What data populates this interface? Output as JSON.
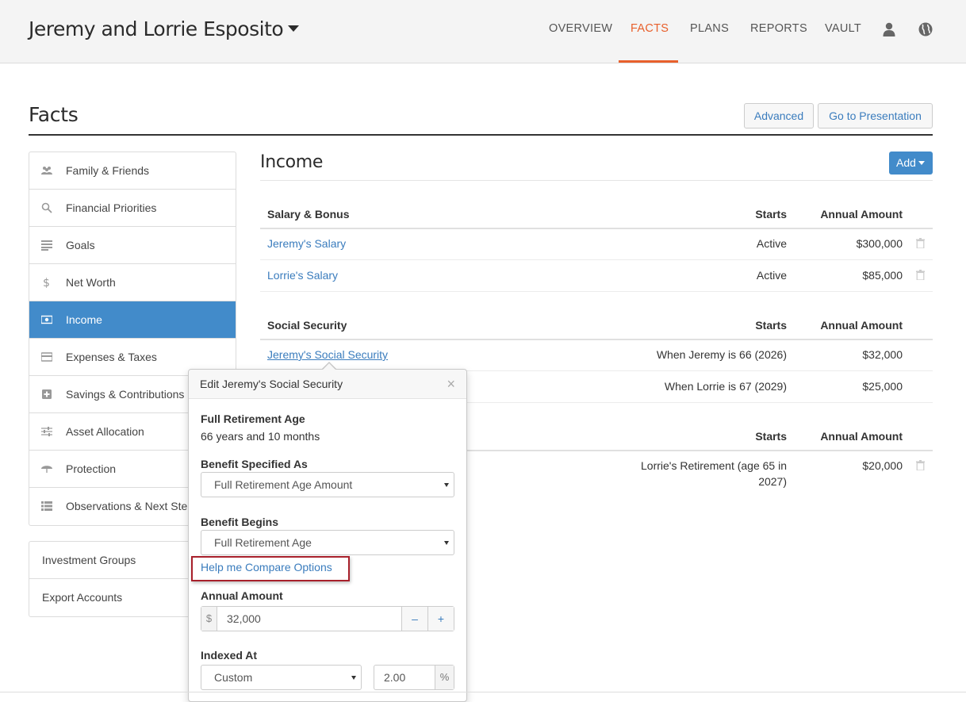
{
  "header": {
    "client_name": "Jeremy and Lorrie Esposito",
    "nav": [
      {
        "label": "OVERVIEW",
        "active": false
      },
      {
        "label": "FACTS",
        "active": true
      },
      {
        "label": "PLANS",
        "active": false
      },
      {
        "label": "REPORTS",
        "active": false
      },
      {
        "label": "VAULT",
        "active": false
      }
    ],
    "icons": [
      "user-icon",
      "globe-icon"
    ],
    "accent_color": "#e8602c"
  },
  "page": {
    "title": "Facts",
    "advanced_label": "Advanced",
    "presentation_label": "Go to Presentation"
  },
  "sidebar": {
    "items": [
      {
        "label": "Family & Friends",
        "icon": "people-icon"
      },
      {
        "label": "Financial Priorities",
        "icon": "search-icon"
      },
      {
        "label": "Goals",
        "icon": "goals-icon"
      },
      {
        "label": "Net Worth",
        "icon": "dollar-icon"
      },
      {
        "label": "Income",
        "icon": "money-icon",
        "active": true
      },
      {
        "label": "Expenses & Taxes",
        "icon": "credit-card-icon"
      },
      {
        "label": "Savings & Contributions",
        "icon": "plus-square-icon"
      },
      {
        "label": "Asset Allocation",
        "icon": "sliders-icon"
      },
      {
        "label": "Protection",
        "icon": "umbrella-icon"
      },
      {
        "label": "Observations & Next Ste",
        "icon": "list-icon"
      }
    ],
    "secondary": [
      {
        "label": "Investment Groups"
      },
      {
        "label": "Export Accounts"
      }
    ],
    "active_color": "#428bca"
  },
  "income": {
    "title": "Income",
    "add_label": "Add",
    "salary_table": {
      "header": {
        "name": "Salary & Bonus",
        "starts": "Starts",
        "amount": "Annual Amount"
      },
      "rows": [
        {
          "name": "Jeremy's Salary",
          "starts": "Active",
          "amount": "$300,000"
        },
        {
          "name": "Lorrie's Salary",
          "starts": "Active",
          "amount": "$85,000"
        }
      ]
    },
    "ss_table": {
      "header": {
        "name": "Social Security",
        "starts": "Starts",
        "amount": "Annual Amount"
      },
      "rows": [
        {
          "name": "Jeremy's Social Security",
          "starts": "When Jeremy is 66 (2026)",
          "amount": "$32,000"
        },
        {
          "name": "",
          "starts": "When Lorrie is 67 (2029)",
          "amount": "$25,000"
        }
      ]
    },
    "other_table": {
      "header": {
        "starts": "Starts",
        "amount": "Annual Amount"
      },
      "rows": [
        {
          "starts_line1": "Lorrie's Retirement (age 65 in",
          "starts_line2": "2027)",
          "amount": "$20,000"
        }
      ]
    }
  },
  "popover": {
    "title": "Edit Jeremy's Social Security",
    "close": "×",
    "fra_label": "Full Retirement Age",
    "fra_value": "66 years and 10 months",
    "benefit_specified_label": "Benefit Specified As",
    "benefit_specified_value": "Full Retirement Age Amount",
    "benefit_begins_label": "Benefit Begins",
    "benefit_begins_value": "Full Retirement Age",
    "compare_link": "Help me Compare Options",
    "annual_amount_label": "Annual Amount",
    "currency_symbol": "$",
    "annual_amount_value": "32,000",
    "minus": "–",
    "plus": "+",
    "indexed_label": "Indexed At",
    "indexed_select": "Custom",
    "indexed_value": "2.00",
    "percent": "%"
  }
}
